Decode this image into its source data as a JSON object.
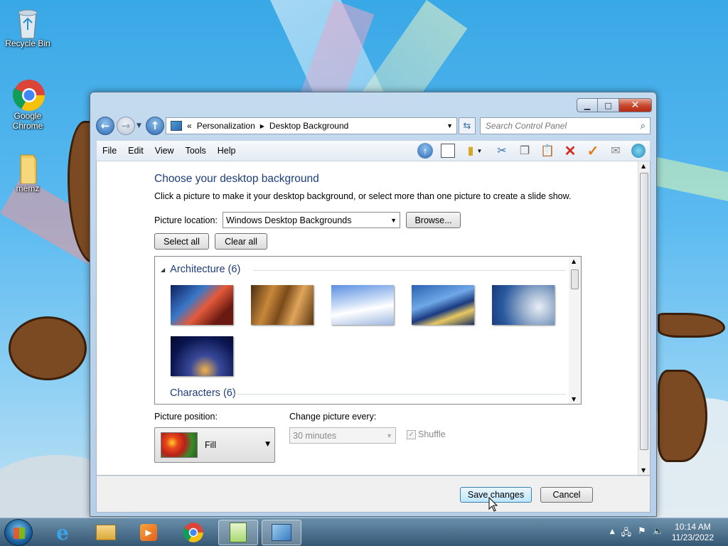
{
  "desktop": {
    "icons": [
      {
        "label": "Recycle Bin",
        "icon": "recycle-bin-icon"
      },
      {
        "label": "Google Chrome",
        "icon": "chrome-icon"
      },
      {
        "label": "memz",
        "icon": "folder-icon"
      }
    ]
  },
  "window": {
    "breadcrumb": {
      "root": "«",
      "items": [
        "Personalization",
        "Desktop Background"
      ]
    },
    "search_placeholder": "Search Control Panel",
    "menu": [
      "File",
      "Edit",
      "View",
      "Tools",
      "Help"
    ],
    "heading": "Choose your desktop background",
    "subheading": "Click a picture to make it your desktop background, or select more than one picture to create a slide show.",
    "picture_location_label": "Picture location:",
    "picture_location_value": "Windows Desktop Backgrounds",
    "browse_label": "Browse...",
    "select_all_label": "Select all",
    "clear_all_label": "Clear all",
    "groups": [
      {
        "title": "Architecture (6)",
        "thumb_count": 6
      },
      {
        "title": "Characters (6)"
      }
    ],
    "picture_position_label": "Picture position:",
    "picture_position_value": "Fill",
    "change_every_label": "Change picture every:",
    "change_every_value": "30 minutes",
    "shuffle_label": "Shuffle",
    "shuffle_checked": true,
    "save_label": "Save changes",
    "cancel_label": "Cancel"
  },
  "taskbar": {
    "time": "10:14 AM",
    "date": "11/23/2022",
    "pinned": [
      "internet-explorer-icon",
      "explorer-icon",
      "media-player-icon",
      "chrome-icon",
      "notepad-icon",
      "control-panel-icon"
    ]
  }
}
